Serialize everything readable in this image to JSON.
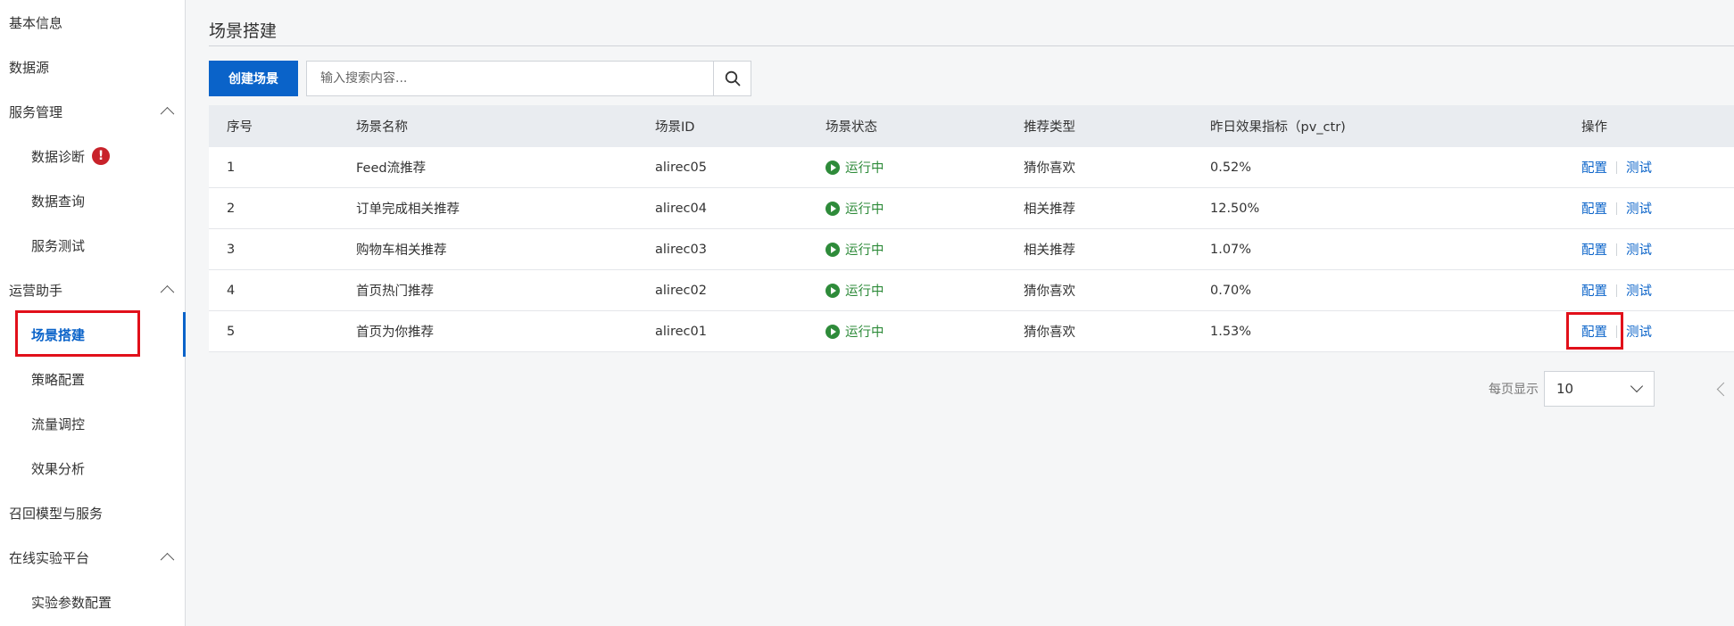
{
  "sidebar": {
    "items": [
      {
        "label": "基本信息"
      },
      {
        "label": "数据源"
      },
      {
        "label": "服务管理"
      },
      {
        "label": "数据诊断"
      },
      {
        "label": "数据查询"
      },
      {
        "label": "服务测试"
      },
      {
        "label": "运营助手"
      },
      {
        "label": "场景搭建"
      },
      {
        "label": "策略配置"
      },
      {
        "label": "流量调控"
      },
      {
        "label": "效果分析"
      },
      {
        "label": "召回模型与服务"
      },
      {
        "label": "在线实验平台"
      },
      {
        "label": "实验参数配置"
      }
    ],
    "alert_glyph": "!"
  },
  "page": {
    "title": "场景搭建"
  },
  "toolbar": {
    "create_label": "创建场景",
    "search_placeholder": "输入搜索内容..."
  },
  "table": {
    "headers": {
      "index": "序号",
      "name": "场景名称",
      "id": "场景ID",
      "status": "场景状态",
      "type": "推荐类型",
      "metric": "昨日效果指标（pv_ctr)",
      "ops": "操作"
    },
    "rows": [
      {
        "index": "1",
        "name": "Feed流推荐",
        "id": "alirec05",
        "status": "运行中",
        "type": "猜你喜欢",
        "metric": "0.52%",
        "op1": "配置",
        "op2": "测试"
      },
      {
        "index": "2",
        "name": "订单完成相关推荐",
        "id": "alirec04",
        "status": "运行中",
        "type": "相关推荐",
        "metric": "12.50%",
        "op1": "配置",
        "op2": "测试"
      },
      {
        "index": "3",
        "name": "购物车相关推荐",
        "id": "alirec03",
        "status": "运行中",
        "type": "相关推荐",
        "metric": "1.07%",
        "op1": "配置",
        "op2": "测试"
      },
      {
        "index": "4",
        "name": "首页热门推荐",
        "id": "alirec02",
        "status": "运行中",
        "type": "猜你喜欢",
        "metric": "0.70%",
        "op1": "配置",
        "op2": "测试"
      },
      {
        "index": "5",
        "name": "首页为你推荐",
        "id": "alirec01",
        "status": "运行中",
        "type": "猜你喜欢",
        "metric": "1.53%",
        "op1": "配置",
        "op2": "测试"
      }
    ]
  },
  "pagination": {
    "page_size_label": "每页显示",
    "page_size_value": "10"
  },
  "colors": {
    "accent": "#0a63c9",
    "running": "#2e8b3a",
    "highlight": "#e1101a",
    "alert": "#c8222a"
  }
}
